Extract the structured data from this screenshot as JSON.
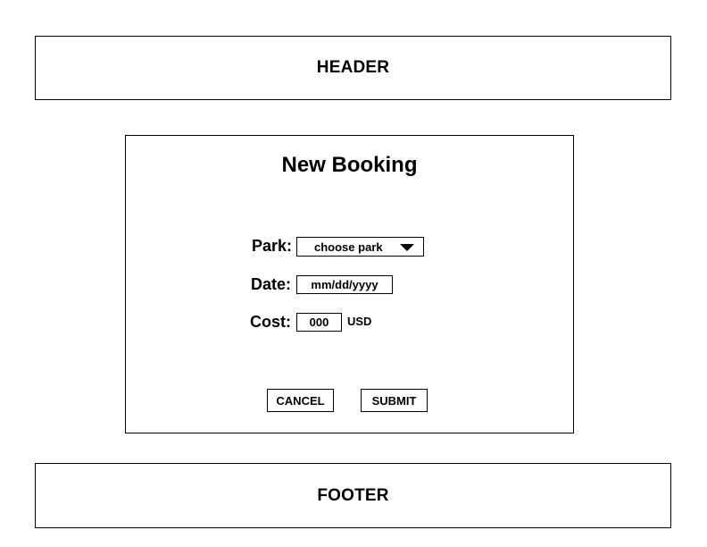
{
  "header": {
    "title": "HEADER"
  },
  "booking_form": {
    "title": "New Booking",
    "park": {
      "label": "Park:",
      "selected": "choose park",
      "icon": "dropdown-triangle-icon"
    },
    "date": {
      "label": "Date:",
      "value": "mm/dd/yyyy"
    },
    "cost": {
      "label": "Cost:",
      "value": "000",
      "unit": "USD"
    },
    "buttons": {
      "cancel": "CANCEL",
      "submit": "SUBMIT"
    }
  },
  "footer": {
    "title": "FOOTER"
  },
  "colors": {
    "border": "#000000",
    "background": "#ffffff",
    "text": "#000000"
  }
}
